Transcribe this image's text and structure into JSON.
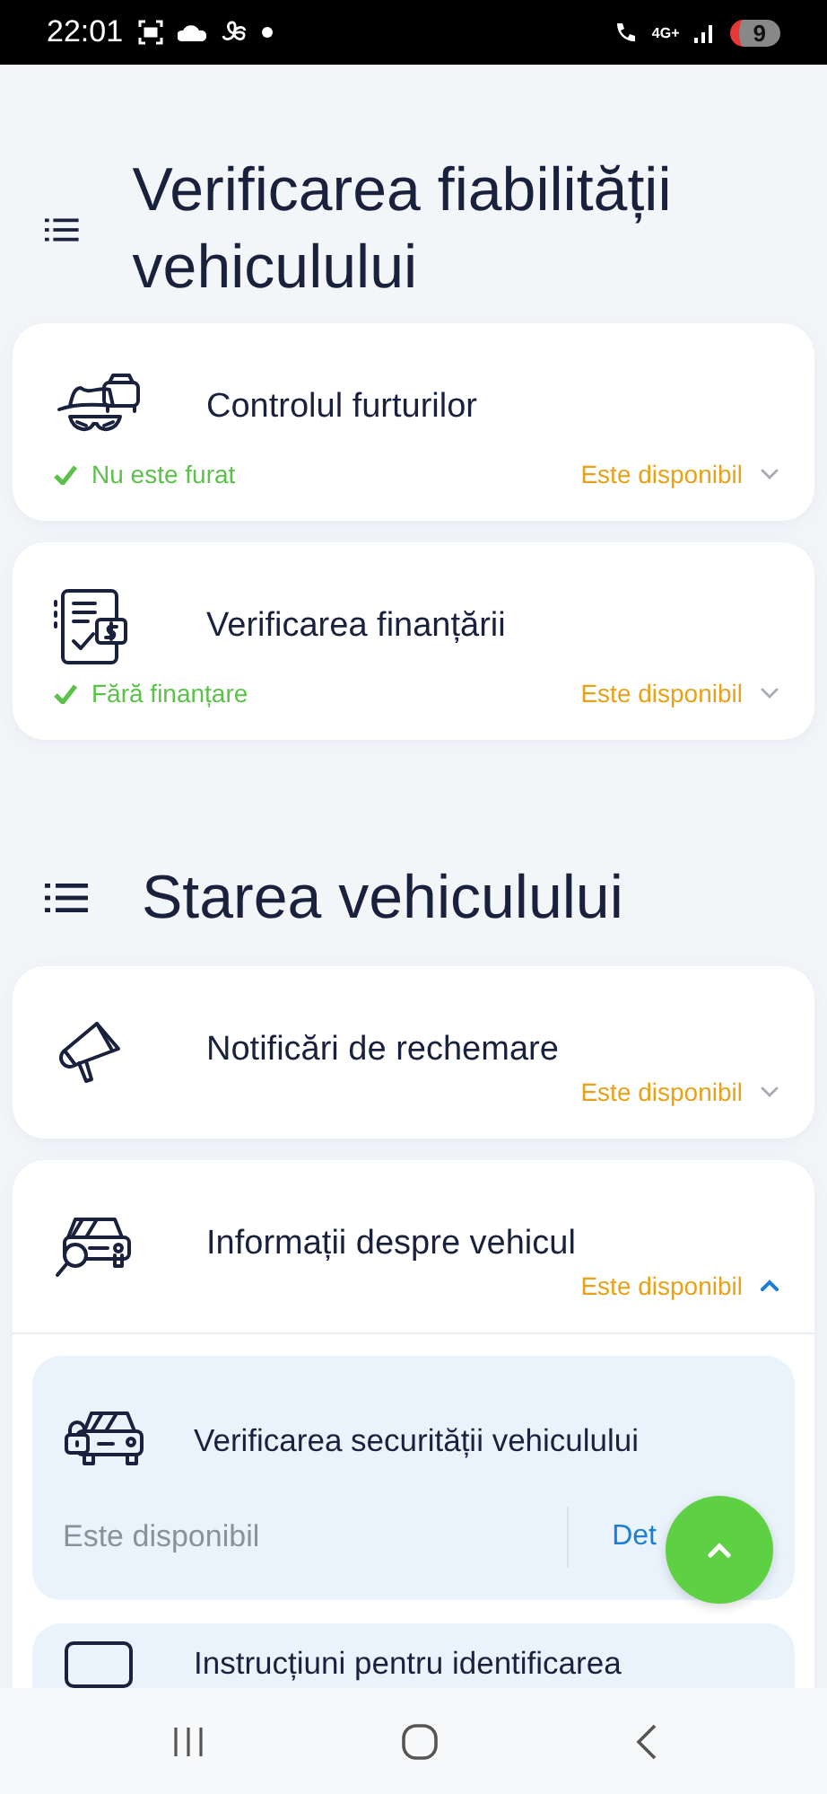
{
  "status_bar": {
    "time": "22:01",
    "network": "4G+",
    "battery": "9"
  },
  "sections": [
    {
      "title": "Verificarea fiabilității vehiculului",
      "items": [
        {
          "title": "Controlul furturilor",
          "status": {
            "text": "Nu este furat",
            "ok": true
          },
          "availability": "Este disponibil",
          "expanded": false
        },
        {
          "title": "Verificarea finanțării",
          "status": {
            "text": "Fără finanțare",
            "ok": true
          },
          "availability": "Este disponibil",
          "expanded": false
        }
      ]
    },
    {
      "title": "Starea vehiculului",
      "items": [
        {
          "title": "Notificări de rechemare",
          "availability": "Este disponibil",
          "expanded": false
        },
        {
          "title": "Informații despre vehicul",
          "availability": "Este disponibil",
          "expanded": true,
          "details": [
            {
              "title": "Verificarea securității vehiculului",
              "availability": "Este disponibil",
              "link": "Det"
            },
            {
              "title": "Instrucțiuni pentru identificarea"
            }
          ]
        }
      ]
    }
  ]
}
